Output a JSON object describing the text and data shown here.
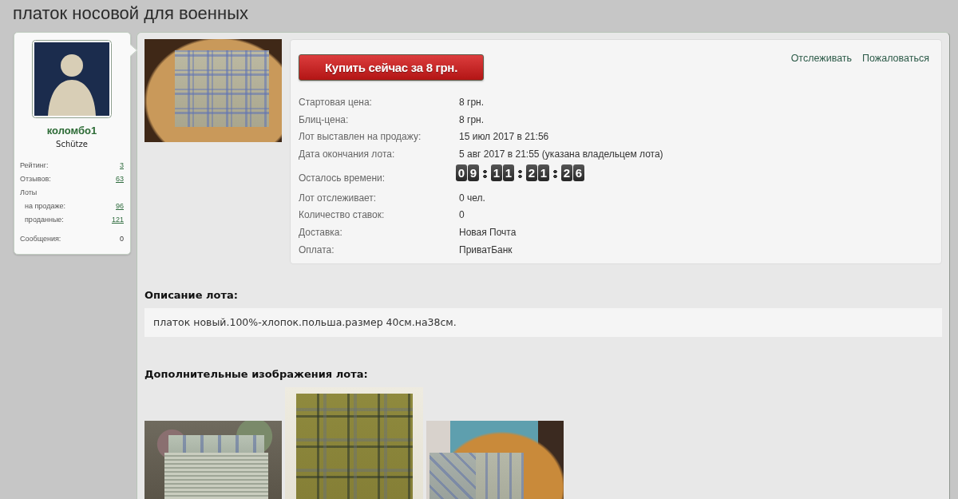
{
  "page_title": "платок носовой для военных",
  "seller": {
    "username": "коломбо1",
    "rank": "Schütze",
    "stats": [
      {
        "label": "Рейтинг:",
        "value": "3",
        "kind": "link"
      },
      {
        "label": "Отзывов:",
        "value": "63",
        "kind": "link"
      },
      {
        "label": "Лоты",
        "kind": "group",
        "children": [
          {
            "label": "на продаже:",
            "value": "96",
            "kind": "link"
          },
          {
            "label": "проданные:",
            "value": "121",
            "kind": "link"
          }
        ]
      },
      {
        "label": "Сообщения:",
        "value": "0",
        "kind": "text"
      }
    ]
  },
  "lot": {
    "buy_button": "Купить сейчас за 8 грн.",
    "actions": [
      "Отслеживать",
      "Пожаловаться"
    ],
    "details": [
      {
        "label": "Стартовая цена:",
        "value": "8 грн.",
        "kind": "text"
      },
      {
        "label": "Блиц-цена:",
        "value": "8 грн.",
        "kind": "text"
      },
      {
        "label": "Лот выставлен на продажу:",
        "value": "15 июл 2017 в 21:56",
        "kind": "text"
      },
      {
        "label": "Дата окончания лота:",
        "value": "5 авг 2017 в 21:55 (указана владельцем лота)",
        "kind": "text"
      },
      {
        "label": "Осталось времени:",
        "kind": "countdown",
        "digits": [
          [
            "0",
            "9"
          ],
          [
            "1",
            "1"
          ],
          [
            "2",
            "1"
          ],
          [
            "2",
            "6"
          ]
        ]
      },
      {
        "label": "Лот отслеживает:",
        "value": "0 чел.",
        "kind": "text"
      },
      {
        "label": "Количество ставок:",
        "value": "0",
        "kind": "text"
      },
      {
        "label": "Доставка:",
        "value": "Новая Почта",
        "kind": "text"
      },
      {
        "label": "Оплата:",
        "value": "ПриватБанк",
        "kind": "text"
      }
    ]
  },
  "description": {
    "heading": "Описание лота:",
    "text": "платок новый.100%-хлопок.польша.размер 40см.на38см."
  },
  "extra_images": {
    "heading": "Дополнительные изображения лота:",
    "images": [
      {
        "kind": "stack"
      },
      {
        "kind": "olive"
      },
      {
        "kind": "table"
      }
    ]
  }
}
